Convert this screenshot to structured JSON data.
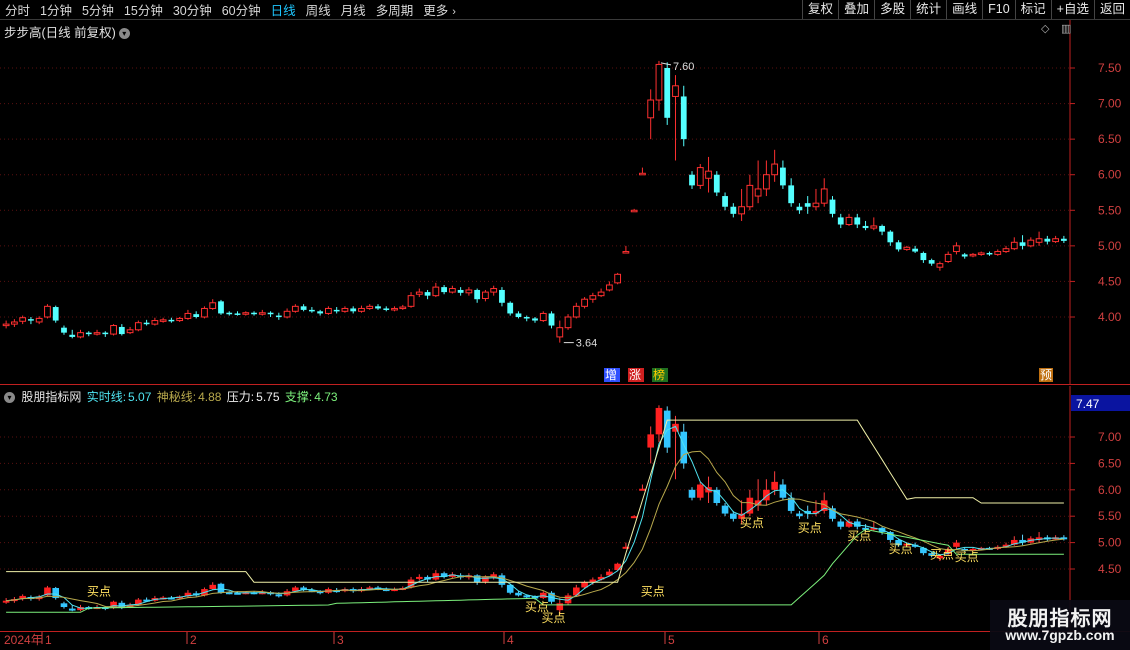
{
  "toolbar": {
    "periods": [
      "分时",
      "1分钟",
      "5分钟",
      "15分钟",
      "30分钟",
      "60分钟",
      "日线",
      "周线",
      "月线",
      "多周期",
      "更多"
    ],
    "active_period": "日线",
    "right_buttons": [
      "复权",
      "叠加",
      "多股",
      "统计",
      "画线",
      "F10",
      "标记",
      "+自选",
      "返回"
    ]
  },
  "main": {
    "title": "步步高(日线 前复权)",
    "price_axis": [
      "7.50",
      "7.00",
      "6.50",
      "6.00",
      "5.50",
      "5.00",
      "4.50",
      "4.00"
    ],
    "high_label": "7.60",
    "low_label": "3.64",
    "tags": [
      "增",
      "涨",
      "榜"
    ],
    "right_tag": "预"
  },
  "indicator": {
    "name": "股朋指标网",
    "realtime_label": "实时线:",
    "realtime_value": "5.07",
    "mystic_label": "神秘线:",
    "mystic_value": "4.88",
    "pressure_label": "压力:",
    "pressure_value": "5.75",
    "support_label": "支撑:",
    "support_value": "4.73",
    "axis": [
      "7.00",
      "6.50",
      "6.00",
      "5.50",
      "5.00",
      "4.50"
    ],
    "current_value": "7.47",
    "buy_label": "买点"
  },
  "dates": {
    "year": "2024年",
    "months": [
      "1",
      "2",
      "3",
      "4",
      "5",
      "6"
    ]
  },
  "watermark": {
    "title": "股朋指标网",
    "url": "www.7gpzb.com"
  },
  "colors": {
    "up": "#ff3030",
    "down": "#54ffff",
    "axis": "#c02020",
    "active": "#1ec7ff"
  },
  "chart_data": {
    "type": "candlestick",
    "price_range": [
      3.55,
      7.8
    ],
    "candles": [
      [
        3.88,
        3.9,
        3.95,
        3.84
      ],
      [
        3.9,
        3.93,
        3.97,
        3.86
      ],
      [
        3.94,
        3.99,
        4.02,
        3.9
      ],
      [
        3.97,
        3.95,
        4.0,
        3.9
      ],
      [
        3.93,
        3.98,
        4.01,
        3.9
      ],
      [
        4.0,
        4.15,
        4.18,
        3.98
      ],
      [
        4.14,
        3.95,
        4.16,
        3.92
      ],
      [
        3.85,
        3.78,
        3.88,
        3.75
      ],
      [
        3.75,
        3.72,
        3.82,
        3.7
      ],
      [
        3.72,
        3.78,
        3.82,
        3.7
      ],
      [
        3.78,
        3.76,
        3.8,
        3.73
      ],
      [
        3.76,
        3.78,
        3.82,
        3.74
      ],
      [
        3.78,
        3.76,
        3.8,
        3.72
      ],
      [
        3.76,
        3.88,
        3.9,
        3.74
      ],
      [
        3.86,
        3.76,
        3.9,
        3.74
      ],
      [
        3.78,
        3.82,
        3.86,
        3.76
      ],
      [
        3.82,
        3.92,
        3.95,
        3.8
      ],
      [
        3.92,
        3.9,
        3.96,
        3.88
      ],
      [
        3.9,
        3.95,
        3.99,
        3.88
      ],
      [
        3.95,
        3.96,
        3.99,
        3.92
      ],
      [
        3.96,
        3.95,
        3.99,
        3.92
      ],
      [
        3.95,
        3.98,
        4.0,
        3.93
      ],
      [
        3.98,
        4.05,
        4.1,
        3.96
      ],
      [
        4.04,
        4.0,
        4.08,
        3.98
      ],
      [
        4.0,
        4.12,
        4.15,
        3.98
      ],
      [
        4.12,
        4.2,
        4.25,
        4.1
      ],
      [
        4.22,
        4.05,
        4.24,
        4.03
      ],
      [
        4.06,
        4.05,
        4.08,
        4.02
      ],
      [
        4.05,
        4.04,
        4.08,
        4.02
      ],
      [
        4.04,
        4.06,
        4.08,
        4.02
      ],
      [
        4.06,
        4.04,
        4.08,
        4.02
      ],
      [
        4.04,
        4.06,
        4.1,
        4.02
      ],
      [
        4.06,
        4.04,
        4.08,
        4.0
      ],
      [
        4.02,
        4.0,
        4.06,
        3.96
      ],
      [
        4.0,
        4.08,
        4.12,
        3.98
      ],
      [
        4.08,
        4.15,
        4.18,
        4.06
      ],
      [
        4.15,
        4.1,
        4.18,
        4.08
      ],
      [
        4.1,
        4.08,
        4.14,
        4.06
      ],
      [
        4.08,
        4.05,
        4.1,
        4.02
      ],
      [
        4.05,
        4.12,
        4.15,
        4.03
      ],
      [
        4.1,
        4.08,
        4.14,
        4.05
      ],
      [
        4.08,
        4.12,
        4.15,
        4.06
      ],
      [
        4.12,
        4.08,
        4.15,
        4.05
      ],
      [
        4.08,
        4.12,
        4.16,
        4.06
      ],
      [
        4.12,
        4.15,
        4.18,
        4.1
      ],
      [
        4.15,
        4.12,
        4.18,
        4.1
      ],
      [
        4.12,
        4.1,
        4.15,
        4.08
      ],
      [
        4.1,
        4.12,
        4.15,
        4.08
      ],
      [
        4.12,
        4.14,
        4.17,
        4.1
      ],
      [
        4.15,
        4.3,
        4.35,
        4.13
      ],
      [
        4.32,
        4.35,
        4.4,
        4.28
      ],
      [
        4.35,
        4.3,
        4.38,
        4.25
      ],
      [
        4.3,
        4.42,
        4.48,
        4.28
      ],
      [
        4.42,
        4.35,
        4.45,
        4.32
      ],
      [
        4.35,
        4.4,
        4.44,
        4.33
      ],
      [
        4.38,
        4.34,
        4.42,
        4.3
      ],
      [
        4.34,
        4.38,
        4.42,
        4.3
      ],
      [
        4.38,
        4.25,
        4.4,
        4.2
      ],
      [
        4.26,
        4.35,
        4.38,
        4.22
      ],
      [
        4.35,
        4.4,
        4.44,
        4.3
      ],
      [
        4.38,
        4.2,
        4.42,
        4.15
      ],
      [
        4.2,
        4.05,
        4.22,
        4.02
      ],
      [
        4.05,
        4.0,
        4.08,
        3.98
      ],
      [
        4.0,
        3.98,
        4.02,
        3.94
      ],
      [
        3.98,
        3.95,
        4.0,
        3.92
      ],
      [
        3.95,
        4.05,
        4.08,
        3.93
      ],
      [
        4.05,
        3.88,
        4.08,
        3.84
      ],
      [
        3.72,
        3.85,
        3.95,
        3.64
      ],
      [
        3.85,
        4.0,
        4.04,
        3.82
      ],
      [
        4.0,
        4.15,
        4.2,
        3.98
      ],
      [
        4.15,
        4.25,
        4.28,
        4.12
      ],
      [
        4.25,
        4.3,
        4.34,
        4.2
      ],
      [
        4.3,
        4.35,
        4.4,
        4.28
      ],
      [
        4.38,
        4.45,
        4.5,
        4.36
      ],
      [
        4.48,
        4.6,
        4.62,
        4.46
      ],
      [
        4.92,
        4.92,
        5.0,
        4.9
      ],
      [
        5.5,
        5.5,
        5.52,
        5.48
      ],
      [
        6.02,
        6.02,
        6.1,
        6.0
      ],
      [
        6.8,
        7.05,
        7.2,
        6.5
      ],
      [
        7.05,
        7.55,
        7.6,
        6.9
      ],
      [
        7.5,
        6.8,
        7.58,
        6.7
      ],
      [
        7.1,
        7.25,
        7.4,
        6.2
      ],
      [
        7.1,
        6.5,
        7.25,
        6.4
      ],
      [
        6.0,
        5.85,
        6.05,
        5.8
      ],
      [
        5.85,
        6.1,
        6.15,
        5.8
      ],
      [
        5.95,
        6.05,
        6.25,
        5.75
      ],
      [
        6.0,
        5.75,
        6.05,
        5.7
      ],
      [
        5.7,
        5.55,
        5.75,
        5.5
      ],
      [
        5.55,
        5.45,
        5.6,
        5.4
      ],
      [
        5.45,
        5.55,
        5.8,
        5.35
      ],
      [
        5.55,
        5.85,
        6.0,
        5.5
      ],
      [
        5.7,
        5.8,
        6.2,
        5.6
      ],
      [
        5.8,
        6.0,
        6.2,
        5.7
      ],
      [
        6.0,
        6.15,
        6.35,
        5.9
      ],
      [
        6.1,
        5.85,
        6.2,
        5.8
      ],
      [
        5.85,
        5.6,
        5.95,
        5.55
      ],
      [
        5.55,
        5.5,
        5.6,
        5.45
      ],
      [
        5.6,
        5.55,
        5.7,
        5.45
      ],
      [
        5.55,
        5.6,
        5.8,
        5.5
      ],
      [
        5.6,
        5.8,
        5.95,
        5.55
      ],
      [
        5.65,
        5.45,
        5.7,
        5.4
      ],
      [
        5.4,
        5.3,
        5.45,
        5.25
      ],
      [
        5.3,
        5.4,
        5.45,
        5.28
      ],
      [
        5.4,
        5.3,
        5.45,
        5.25
      ],
      [
        5.28,
        5.25,
        5.35,
        5.22
      ],
      [
        5.25,
        5.28,
        5.4,
        5.22
      ],
      [
        5.28,
        5.2,
        5.3,
        5.15
      ],
      [
        5.2,
        5.05,
        5.22,
        5.0
      ],
      [
        5.05,
        4.95,
        5.08,
        4.92
      ],
      [
        4.95,
        4.98,
        5.0,
        4.93
      ],
      [
        4.96,
        4.92,
        5.0,
        4.9
      ],
      [
        4.9,
        4.8,
        4.92,
        4.76
      ],
      [
        4.8,
        4.75,
        4.82,
        4.72
      ],
      [
        4.7,
        4.75,
        4.78,
        4.65
      ],
      [
        4.78,
        4.88,
        4.92,
        4.76
      ],
      [
        4.92,
        5.0,
        5.05,
        4.88
      ],
      [
        4.88,
        4.85,
        4.9,
        4.82
      ],
      [
        4.86,
        4.88,
        4.9,
        4.84
      ],
      [
        4.88,
        4.9,
        4.92,
        4.86
      ],
      [
        4.9,
        4.88,
        4.92,
        4.86
      ],
      [
        4.88,
        4.92,
        4.95,
        4.86
      ],
      [
        4.92,
        4.96,
        5.0,
        4.9
      ],
      [
        4.96,
        5.05,
        5.12,
        4.94
      ],
      [
        5.05,
        5.0,
        5.15,
        4.95
      ],
      [
        5.0,
        5.08,
        5.12,
        4.98
      ],
      [
        5.05,
        5.1,
        5.2,
        5.0
      ],
      [
        5.1,
        5.06,
        5.14,
        5.02
      ],
      [
        5.06,
        5.1,
        5.14,
        5.04
      ],
      [
        5.1,
        5.07,
        5.14,
        5.04
      ]
    ]
  }
}
